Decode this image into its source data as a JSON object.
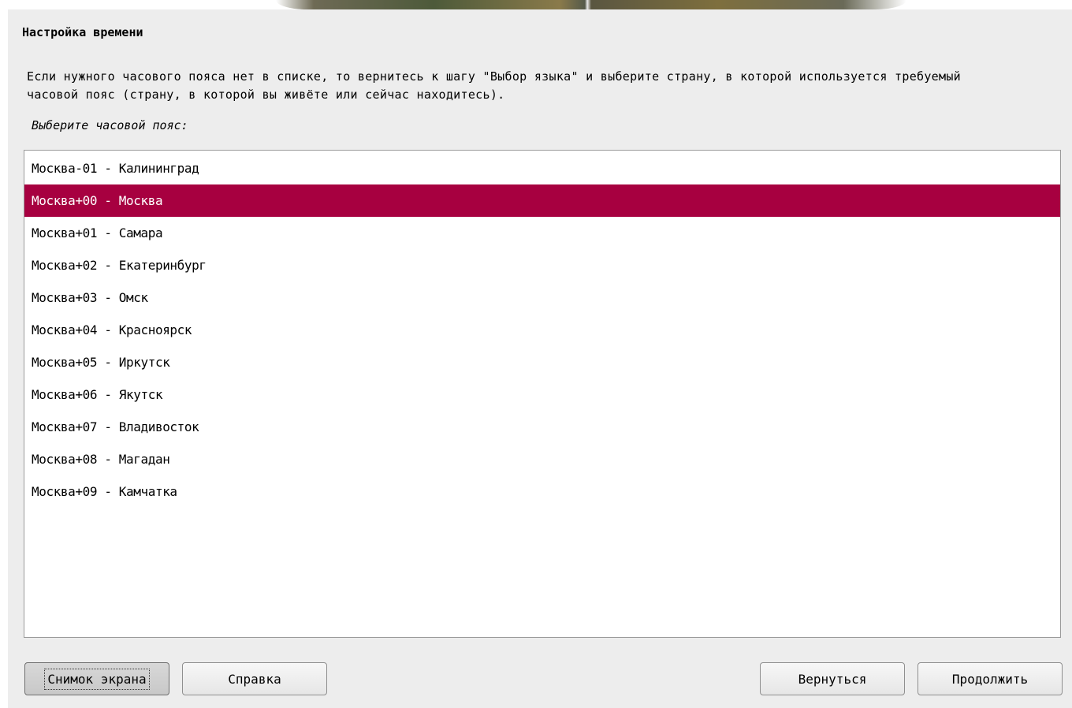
{
  "dialog": {
    "title": "Настройка времени",
    "description": "Если нужного часового пояса нет в списке, то вернитесь к шагу \"Выбор языка\" и выберите страну, в которой используется требуемый часовой пояс (страну, в которой вы живёте или сейчас находитесь).",
    "prompt": "Выберите часовой пояс:"
  },
  "timezones": {
    "selected_index": 1,
    "items": [
      "Москва-01 - Калининград",
      "Москва+00 - Москва",
      "Москва+01 - Самара",
      "Москва+02 - Екатеринбург",
      "Москва+03 - Омск",
      "Москва+04 - Красноярск",
      "Москва+05 - Иркутск",
      "Москва+06 - Якутск",
      "Москва+07 - Владивосток",
      "Москва+08 - Магадан",
      "Москва+09 - Камчатка"
    ]
  },
  "buttons": {
    "screenshot": "Снимок экрана",
    "help": "Справка",
    "back": "Вернуться",
    "continue": "Продолжить"
  },
  "colors": {
    "selection": "#a70040",
    "panel_background": "#ededed"
  }
}
